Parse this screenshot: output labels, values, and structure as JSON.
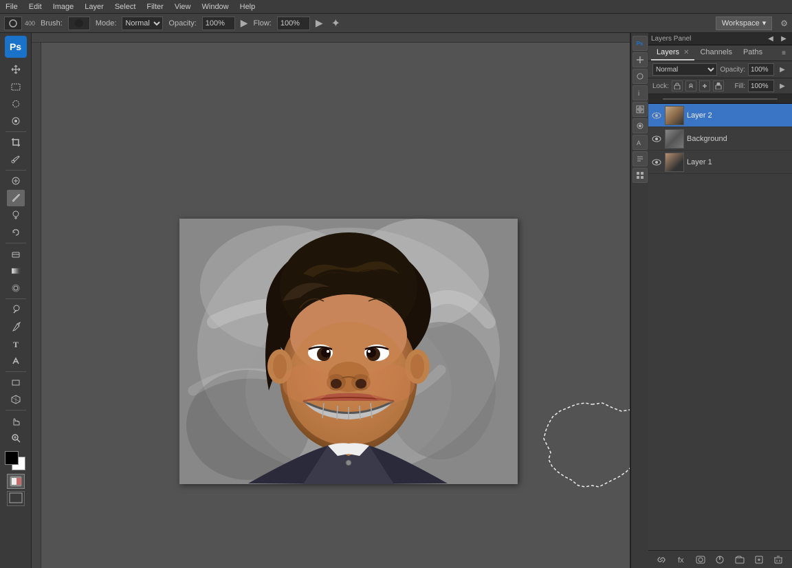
{
  "menu": {
    "items": [
      "File",
      "Edit",
      "Image",
      "Layer",
      "Select",
      "Filter",
      "View",
      "Window",
      "Help"
    ]
  },
  "toolbar": {
    "brush_label": "Brush:",
    "brush_size": "400",
    "mode_label": "Mode:",
    "mode_value": "Normal",
    "opacity_label": "Opacity:",
    "opacity_value": "100%",
    "flow_label": "Flow:",
    "flow_value": "100%",
    "workspace_label": "Workspace"
  },
  "layers_panel": {
    "tabs": [
      {
        "label": "Layers",
        "active": true
      },
      {
        "label": "Channels"
      },
      {
        "label": "Paths"
      }
    ],
    "blend_mode": "Normal",
    "opacity_label": "Opacity:",
    "opacity_value": "100%",
    "lock_label": "Lock:",
    "fill_label": "Fill:",
    "fill_value": "100%",
    "layers": [
      {
        "name": "Layer 2",
        "visible": true,
        "selected": true,
        "thumb": "face"
      },
      {
        "name": "Background",
        "visible": true,
        "selected": false,
        "thumb": "bg"
      },
      {
        "name": "Layer 1",
        "visible": true,
        "selected": false,
        "thumb": "layer1"
      }
    ]
  },
  "colors": {
    "ps_blue": "#1a73c8",
    "layer_selected": "#3a74c5",
    "panel_bg": "#3c3c3c",
    "dark_bg": "#2a2a2a"
  }
}
